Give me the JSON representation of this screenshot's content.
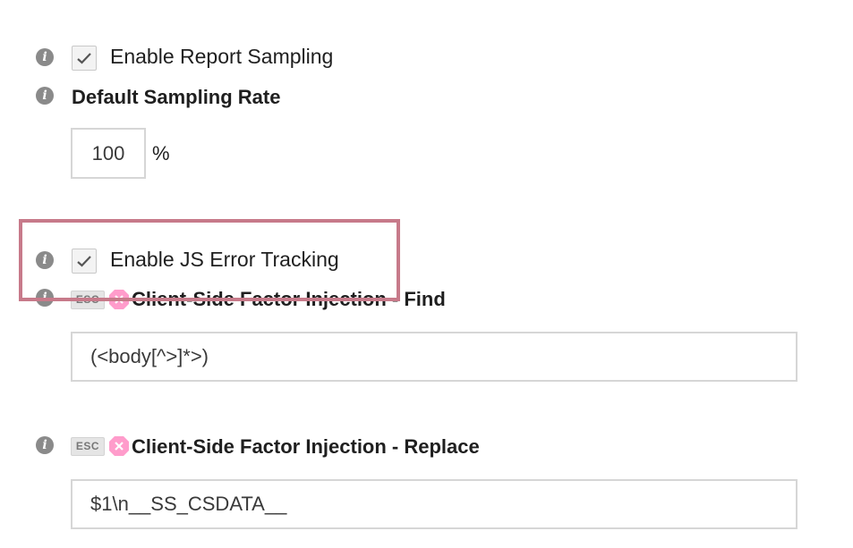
{
  "settings": {
    "enable_report_sampling": {
      "label": "Enable Report Sampling",
      "checked": true
    },
    "default_sampling_rate": {
      "label": "Default Sampling Rate",
      "value": "100",
      "unit": "%"
    },
    "enable_js_error_tracking": {
      "label": "Enable JS Error Tracking",
      "checked": true
    },
    "factor_injection_find": {
      "badge": "ESC",
      "label": "Client-Side Factor Injection - Find",
      "value": "(<body[^>]*>)"
    },
    "factor_injection_replace": {
      "badge": "ESC",
      "label": "Client-Side Factor Injection - Replace",
      "value": "$1\\n__SS_CSDATA__"
    }
  },
  "icons": {
    "info": "info-icon",
    "checkmark": "checkmark-icon",
    "regex": "regex-icon"
  },
  "colors": {
    "highlight": "#c77a8a",
    "regex_icon": "#ff8fc4",
    "info_icon": "#8a8a8a"
  }
}
